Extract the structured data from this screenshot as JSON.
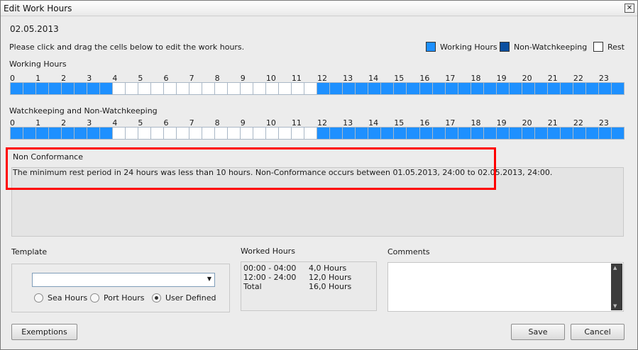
{
  "window": {
    "title": "Edit Work Hours",
    "close_glyph": "✕"
  },
  "date": "02.05.2013",
  "instruction": "Please click and drag the cells below to edit the work hours.",
  "legend": [
    {
      "label": "Working Hours",
      "color": "#1e90ff"
    },
    {
      "label": "Non-Watchkeeping",
      "color": "#0b4fa0"
    },
    {
      "label": "Rest",
      "color": "#ffffff"
    }
  ],
  "hours": [
    "0",
    "1",
    "2",
    "3",
    "4",
    "5",
    "6",
    "7",
    "8",
    "9",
    "10",
    "11",
    "12",
    "13",
    "14",
    "15",
    "16",
    "17",
    "18",
    "19",
    "20",
    "21",
    "22",
    "23"
  ],
  "working_hours": {
    "label": "Working Hours",
    "cells": [
      "W",
      "W",
      "W",
      "W",
      "W",
      "W",
      "W",
      "W",
      "R",
      "R",
      "R",
      "R",
      "R",
      "R",
      "R",
      "R",
      "R",
      "R",
      "R",
      "R",
      "R",
      "R",
      "R",
      "R",
      "W",
      "W",
      "W",
      "W",
      "W",
      "W",
      "W",
      "W",
      "W",
      "W",
      "W",
      "W",
      "W",
      "W",
      "W",
      "W",
      "W",
      "W",
      "W",
      "W",
      "W",
      "W",
      "W",
      "W"
    ]
  },
  "watchkeeping": {
    "label": "Watchkeeping and Non-Watchkeeping",
    "cells": [
      "W",
      "W",
      "W",
      "W",
      "W",
      "W",
      "W",
      "W",
      "R",
      "R",
      "R",
      "R",
      "R",
      "R",
      "R",
      "R",
      "R",
      "R",
      "R",
      "R",
      "R",
      "R",
      "R",
      "R",
      "W",
      "W",
      "W",
      "W",
      "W",
      "W",
      "W",
      "W",
      "W",
      "W",
      "W",
      "W",
      "W",
      "W",
      "W",
      "W",
      "W",
      "W",
      "W",
      "W",
      "W",
      "W",
      "W",
      "W"
    ]
  },
  "non_conformance": {
    "title": "Non Conformance",
    "message": "The minimum rest period in 24 hours was less than 10 hours. Non-Conformance occurs between 01.05.2013, 24:00 to 02.05.2013, 24:00."
  },
  "template": {
    "label": "Template",
    "selected": "",
    "options": [
      "Sea Hours",
      "Port Hours",
      "User Defined"
    ],
    "checked": "User Defined"
  },
  "worked_hours": {
    "label": "Worked Hours",
    "rows": [
      {
        "range": "00:00 - 04:00",
        "value": "4,0 Hours"
      },
      {
        "range": "12:00 - 24:00",
        "value": "12,0 Hours"
      },
      {
        "range": "Total",
        "value": "16,0 Hours"
      }
    ]
  },
  "comments": {
    "label": "Comments",
    "value": ""
  },
  "buttons": {
    "exemptions": "Exemptions",
    "save": "Save",
    "cancel": "Cancel"
  }
}
